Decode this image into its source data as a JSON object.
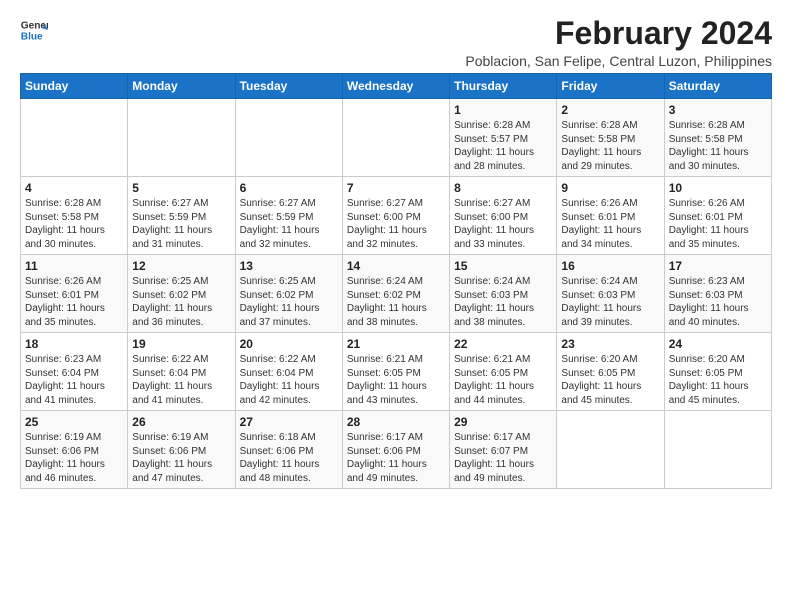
{
  "logo": {
    "line1": "General",
    "line2": "Blue"
  },
  "title": "February 2024",
  "subtitle": "Poblacion, San Felipe, Central Luzon, Philippines",
  "days_of_week": [
    "Sunday",
    "Monday",
    "Tuesday",
    "Wednesday",
    "Thursday",
    "Friday",
    "Saturday"
  ],
  "weeks": [
    [
      {
        "day": "",
        "text": ""
      },
      {
        "day": "",
        "text": ""
      },
      {
        "day": "",
        "text": ""
      },
      {
        "day": "",
        "text": ""
      },
      {
        "day": "1",
        "text": "Sunrise: 6:28 AM\nSunset: 5:57 PM\nDaylight: 11 hours\nand 28 minutes."
      },
      {
        "day": "2",
        "text": "Sunrise: 6:28 AM\nSunset: 5:58 PM\nDaylight: 11 hours\nand 29 minutes."
      },
      {
        "day": "3",
        "text": "Sunrise: 6:28 AM\nSunset: 5:58 PM\nDaylight: 11 hours\nand 30 minutes."
      }
    ],
    [
      {
        "day": "4",
        "text": "Sunrise: 6:28 AM\nSunset: 5:58 PM\nDaylight: 11 hours\nand 30 minutes."
      },
      {
        "day": "5",
        "text": "Sunrise: 6:27 AM\nSunset: 5:59 PM\nDaylight: 11 hours\nand 31 minutes."
      },
      {
        "day": "6",
        "text": "Sunrise: 6:27 AM\nSunset: 5:59 PM\nDaylight: 11 hours\nand 32 minutes."
      },
      {
        "day": "7",
        "text": "Sunrise: 6:27 AM\nSunset: 6:00 PM\nDaylight: 11 hours\nand 32 minutes."
      },
      {
        "day": "8",
        "text": "Sunrise: 6:27 AM\nSunset: 6:00 PM\nDaylight: 11 hours\nand 33 minutes."
      },
      {
        "day": "9",
        "text": "Sunrise: 6:26 AM\nSunset: 6:01 PM\nDaylight: 11 hours\nand 34 minutes."
      },
      {
        "day": "10",
        "text": "Sunrise: 6:26 AM\nSunset: 6:01 PM\nDaylight: 11 hours\nand 35 minutes."
      }
    ],
    [
      {
        "day": "11",
        "text": "Sunrise: 6:26 AM\nSunset: 6:01 PM\nDaylight: 11 hours\nand 35 minutes."
      },
      {
        "day": "12",
        "text": "Sunrise: 6:25 AM\nSunset: 6:02 PM\nDaylight: 11 hours\nand 36 minutes."
      },
      {
        "day": "13",
        "text": "Sunrise: 6:25 AM\nSunset: 6:02 PM\nDaylight: 11 hours\nand 37 minutes."
      },
      {
        "day": "14",
        "text": "Sunrise: 6:24 AM\nSunset: 6:02 PM\nDaylight: 11 hours\nand 38 minutes."
      },
      {
        "day": "15",
        "text": "Sunrise: 6:24 AM\nSunset: 6:03 PM\nDaylight: 11 hours\nand 38 minutes."
      },
      {
        "day": "16",
        "text": "Sunrise: 6:24 AM\nSunset: 6:03 PM\nDaylight: 11 hours\nand 39 minutes."
      },
      {
        "day": "17",
        "text": "Sunrise: 6:23 AM\nSunset: 6:03 PM\nDaylight: 11 hours\nand 40 minutes."
      }
    ],
    [
      {
        "day": "18",
        "text": "Sunrise: 6:23 AM\nSunset: 6:04 PM\nDaylight: 11 hours\nand 41 minutes."
      },
      {
        "day": "19",
        "text": "Sunrise: 6:22 AM\nSunset: 6:04 PM\nDaylight: 11 hours\nand 41 minutes."
      },
      {
        "day": "20",
        "text": "Sunrise: 6:22 AM\nSunset: 6:04 PM\nDaylight: 11 hours\nand 42 minutes."
      },
      {
        "day": "21",
        "text": "Sunrise: 6:21 AM\nSunset: 6:05 PM\nDaylight: 11 hours\nand 43 minutes."
      },
      {
        "day": "22",
        "text": "Sunrise: 6:21 AM\nSunset: 6:05 PM\nDaylight: 11 hours\nand 44 minutes."
      },
      {
        "day": "23",
        "text": "Sunrise: 6:20 AM\nSunset: 6:05 PM\nDaylight: 11 hours\nand 45 minutes."
      },
      {
        "day": "24",
        "text": "Sunrise: 6:20 AM\nSunset: 6:05 PM\nDaylight: 11 hours\nand 45 minutes."
      }
    ],
    [
      {
        "day": "25",
        "text": "Sunrise: 6:19 AM\nSunset: 6:06 PM\nDaylight: 11 hours\nand 46 minutes."
      },
      {
        "day": "26",
        "text": "Sunrise: 6:19 AM\nSunset: 6:06 PM\nDaylight: 11 hours\nand 47 minutes."
      },
      {
        "day": "27",
        "text": "Sunrise: 6:18 AM\nSunset: 6:06 PM\nDaylight: 11 hours\nand 48 minutes."
      },
      {
        "day": "28",
        "text": "Sunrise: 6:17 AM\nSunset: 6:06 PM\nDaylight: 11 hours\nand 49 minutes."
      },
      {
        "day": "29",
        "text": "Sunrise: 6:17 AM\nSunset: 6:07 PM\nDaylight: 11 hours\nand 49 minutes."
      },
      {
        "day": "",
        "text": ""
      },
      {
        "day": "",
        "text": ""
      }
    ]
  ]
}
